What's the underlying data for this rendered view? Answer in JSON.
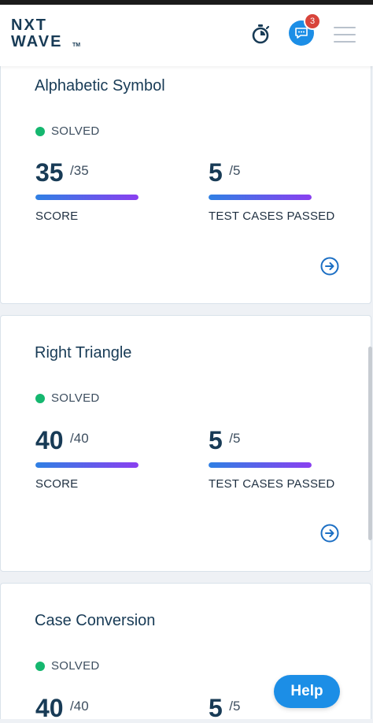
{
  "header": {
    "logo": {
      "line1": "NXT",
      "line2": "WAVE",
      "tm": "TM"
    },
    "chat_badge_count": "3",
    "icons": {
      "timer": "stopwatch-icon",
      "chat": "chat-bubble-icon",
      "menu": "hamburger-menu-icon"
    }
  },
  "colors": {
    "accent_blue": "#1c8ee6",
    "solved_green": "#15b76f",
    "badge_red": "#d8443b",
    "progress_start": "#2f80e4",
    "progress_end": "#8a3ff0",
    "title_navy": "#183b56"
  },
  "cards": [
    {
      "title": "Alphabetic Symbol",
      "status": "SOLVED",
      "score": {
        "value": "35",
        "total": "/35",
        "label": "SCORE",
        "fraction": 1.0
      },
      "tests": {
        "value": "5",
        "total": "/5",
        "label": "TEST CASES PASSED",
        "fraction": 1.0
      }
    },
    {
      "title": "Right Triangle",
      "status": "SOLVED",
      "score": {
        "value": "40",
        "total": "/40",
        "label": "SCORE",
        "fraction": 1.0
      },
      "tests": {
        "value": "5",
        "total": "/5",
        "label": "TEST CASES PASSED",
        "fraction": 1.0
      }
    },
    {
      "title": "Case Conversion",
      "status": "SOLVED",
      "score": {
        "value": "40",
        "total": "/40"
      },
      "tests": {
        "value": "5",
        "total": "/5"
      }
    }
  ],
  "help": {
    "label": "Help"
  }
}
